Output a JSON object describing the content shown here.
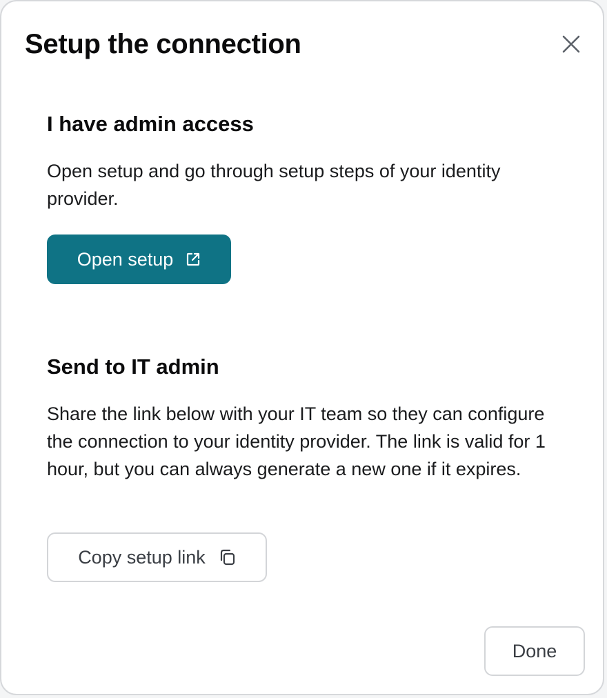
{
  "modal": {
    "title": "Setup the connection"
  },
  "admin_section": {
    "title": "I have admin access",
    "description": "Open setup and go through setup steps of your identity provider.",
    "button_label": "Open setup",
    "button_icon": "external-link-icon"
  },
  "it_section": {
    "title": "Send to IT admin",
    "description": "Share the link below with your IT team so they can configure the connection to your identity provider. The link is valid for 1 hour, but you can always generate a new one if it expires.",
    "button_label": "Copy setup link",
    "button_icon": "copy-icon"
  },
  "footer": {
    "done_label": "Done"
  },
  "colors": {
    "primary": "#0f7385",
    "border": "#d3d5d8",
    "text": "#0b0b0c"
  }
}
